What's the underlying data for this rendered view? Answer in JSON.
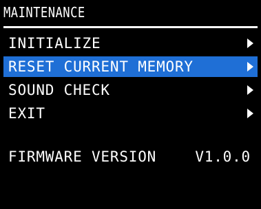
{
  "screen": {
    "title": "MAINTENANCE",
    "background_color": "#000000",
    "text_color": "#ffffff",
    "selection_color": "#1f6fd6"
  },
  "menu": {
    "items": [
      {
        "label": "INITIALIZE",
        "icon": "arrow-right-icon",
        "selected": false
      },
      {
        "label": "RESET CURRENT MEMORY",
        "icon": "arrow-right-icon",
        "selected": true
      },
      {
        "label": "SOUND CHECK",
        "icon": "arrow-right-icon",
        "selected": false
      },
      {
        "label": "EXIT",
        "icon": "arrow-right-icon",
        "selected": false
      }
    ]
  },
  "firmware": {
    "label": "FIRMWARE VERSION",
    "value": "V1.0.0"
  }
}
